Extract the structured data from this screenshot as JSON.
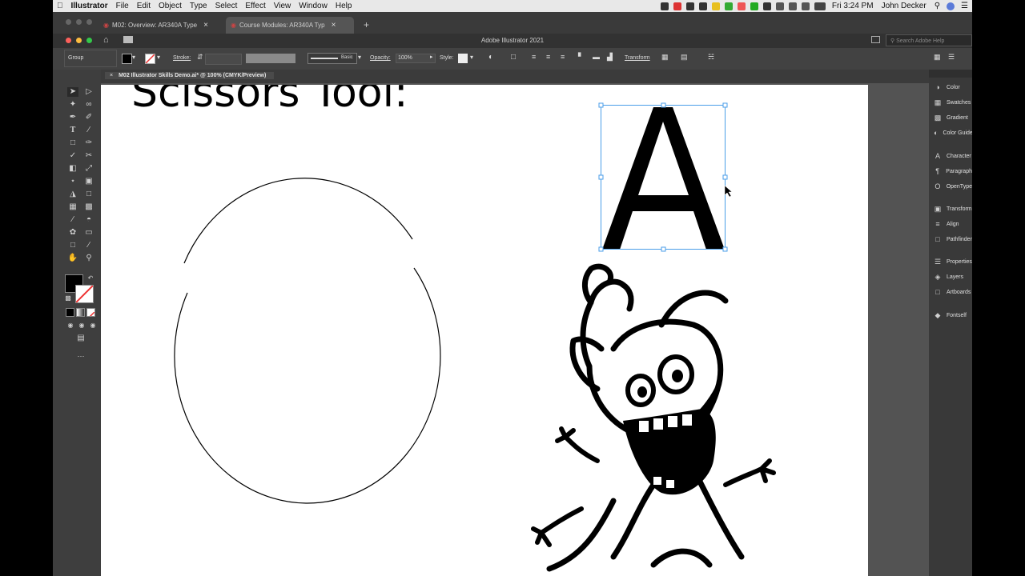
{
  "menubar": {
    "app_name": "Illustrator",
    "items": [
      "File",
      "Edit",
      "Object",
      "Type",
      "Select",
      "Effect",
      "View",
      "Window",
      "Help"
    ],
    "clock": "Fri 3:24 PM",
    "user": "John Decker"
  },
  "browser_tabs": [
    {
      "label": "M02: Overview: AR340A Type",
      "close": "×"
    },
    {
      "label": "Course Modules: AR340A Typ",
      "close": "×"
    }
  ],
  "new_tab": "+",
  "titlebar": {
    "title": "Adobe Illustrator 2021",
    "search_placeholder": "Search Adobe Help"
  },
  "controlbar": {
    "selection": "Group",
    "stroke_label": "Stroke:",
    "brush": "Basic",
    "opacity_label": "Opacity:",
    "opacity_value": "100%",
    "style_label": "Style:",
    "transform": "Transform"
  },
  "document_tab": {
    "close": "×",
    "label": "M02 Illustrator Skills Demo.ai* @ 100% (CMYK/Preview)"
  },
  "artboard": {
    "heading": "Scissors Tool:",
    "letter": "A"
  },
  "panels": [
    {
      "label": "Color",
      "icon": "color-icon"
    },
    {
      "label": "Swatches",
      "icon": "swatches-icon"
    },
    {
      "label": "Gradient",
      "icon": "gradient-icon"
    },
    {
      "label": "Color Guide",
      "icon": "color-guide-icon"
    },
    {
      "label": "Character",
      "icon": "character-icon"
    },
    {
      "label": "Paragraph",
      "icon": "paragraph-icon"
    },
    {
      "label": "OpenType",
      "icon": "opentype-icon"
    },
    {
      "label": "Transform",
      "icon": "transform-icon"
    },
    {
      "label": "Align",
      "icon": "align-icon"
    },
    {
      "label": "Pathfinder",
      "icon": "pathfinder-icon"
    },
    {
      "label": "Properties",
      "icon": "properties-icon"
    },
    {
      "label": "Layers",
      "icon": "layers-icon"
    },
    {
      "label": "Artboards",
      "icon": "artboards-icon"
    },
    {
      "label": "Fontself",
      "icon": "fontself-icon"
    }
  ],
  "colors": {
    "fill": "#000000",
    "accent": "#4a9ee8"
  }
}
